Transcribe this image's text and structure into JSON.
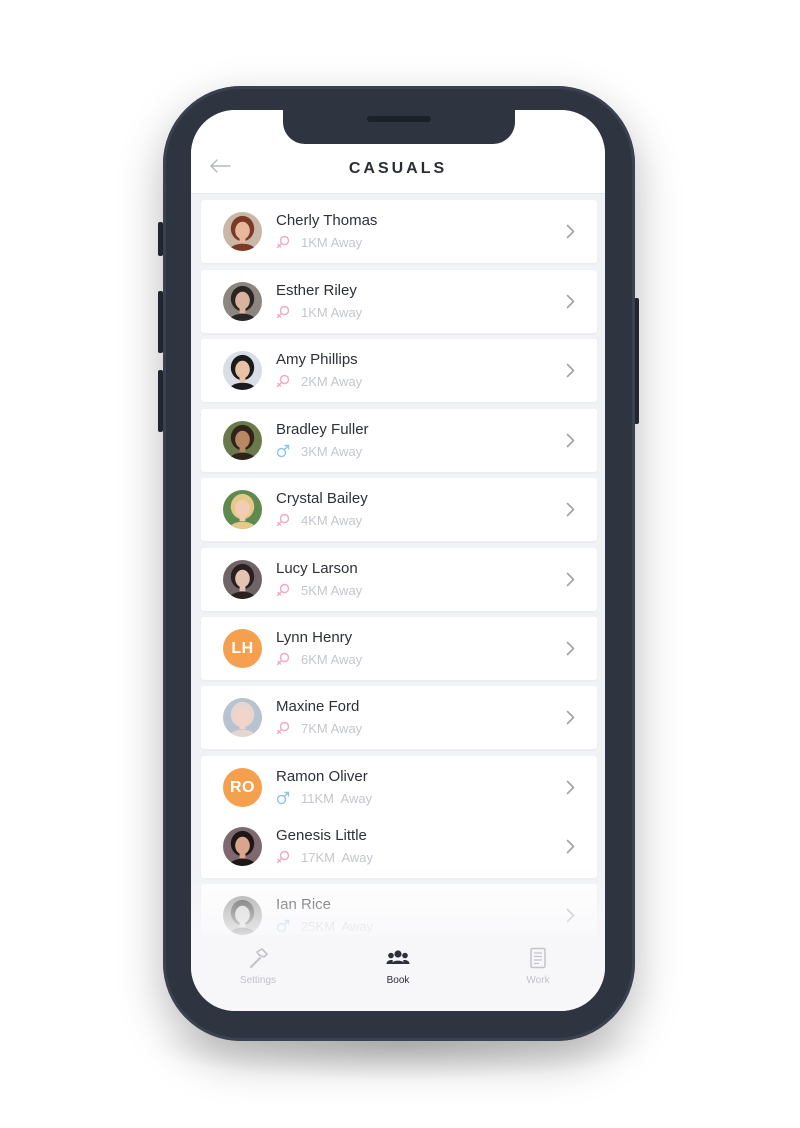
{
  "header": {
    "title": "CASUALS"
  },
  "people": [
    {
      "name": "Cherly Thomas",
      "distance": "1KM Away",
      "gender": "female",
      "avatar_type": "photo",
      "initials": "",
      "colors": {
        "hair": "#7a3a25",
        "skin": "#e9b79c",
        "bg": "#c9b7a8"
      }
    },
    {
      "name": "Esther Riley",
      "distance": "1KM Away",
      "gender": "female",
      "avatar_type": "photo",
      "initials": "",
      "colors": {
        "hair": "#2b2523",
        "skin": "#d9b3a0",
        "bg": "#8d8580"
      }
    },
    {
      "name": "Amy Phillips",
      "distance": "2KM Away",
      "gender": "female",
      "avatar_type": "photo",
      "initials": "",
      "colors": {
        "hair": "#1b1a1c",
        "skin": "#e8c2a7",
        "bg": "#d9dde6"
      }
    },
    {
      "name": "Bradley Fuller",
      "distance": "3KM Away",
      "gender": "male",
      "avatar_type": "photo",
      "initials": "",
      "colors": {
        "hair": "#2e2419",
        "skin": "#b98762",
        "bg": "#6b7a4d"
      }
    },
    {
      "name": "Crystal Bailey",
      "distance": "4KM Away",
      "gender": "female",
      "avatar_type": "photo",
      "initials": "",
      "colors": {
        "hair": "#e6c98a",
        "skin": "#f1cdb4",
        "bg": "#5e8a4e"
      }
    },
    {
      "name": "Lucy Larson",
      "distance": "5KM Away",
      "gender": "female",
      "avatar_type": "photo",
      "initials": "",
      "colors": {
        "hair": "#2a2020",
        "skin": "#e4c3b1",
        "bg": "#6f6468"
      }
    },
    {
      "name": "Lynn Henry",
      "distance": "6KM Away",
      "gender": "female",
      "avatar_type": "initials",
      "initials": "LH",
      "colors": {
        "hair": "",
        "skin": "",
        "bg": "#f5a04f"
      }
    },
    {
      "name": "Maxine Ford",
      "distance": "7KM Away",
      "gender": "female",
      "avatar_type": "photo",
      "initials": "",
      "colors": {
        "hair": "#e7d6cf",
        "skin": "#f2d5c8",
        "bg": "#b7c3cf"
      }
    },
    {
      "name": "Ramon Oliver",
      "distance": "11KM  Away",
      "gender": "male",
      "avatar_type": "initials",
      "initials": "RO",
      "colors": {
        "hair": "",
        "skin": "",
        "bg": "#f5a04f"
      }
    },
    {
      "name": "Genesis Little",
      "distance": "17KM  Away",
      "gender": "female",
      "avatar_type": "photo",
      "initials": "",
      "colors": {
        "hair": "#1e1718",
        "skin": "#d9a68b",
        "bg": "#7e6a6e"
      }
    },
    {
      "name": "Ian Rice",
      "distance": "25KM  Away",
      "gender": "male",
      "avatar_type": "photo",
      "initials": "",
      "colors": {
        "hair": "#3a3a3a",
        "skin": "#cfcfcf",
        "bg": "#9a9a9a"
      }
    }
  ],
  "tabs": [
    {
      "label": "Settings",
      "icon": "hammer-icon",
      "active": false
    },
    {
      "label": "Book",
      "icon": "people-icon",
      "active": true
    },
    {
      "label": "Work",
      "icon": "document-icon",
      "active": false
    }
  ],
  "colors": {
    "female": "#f4a6c6",
    "male": "#8ec6e8",
    "initials_bg": "#f5a04f",
    "frame": "#2e3440"
  }
}
